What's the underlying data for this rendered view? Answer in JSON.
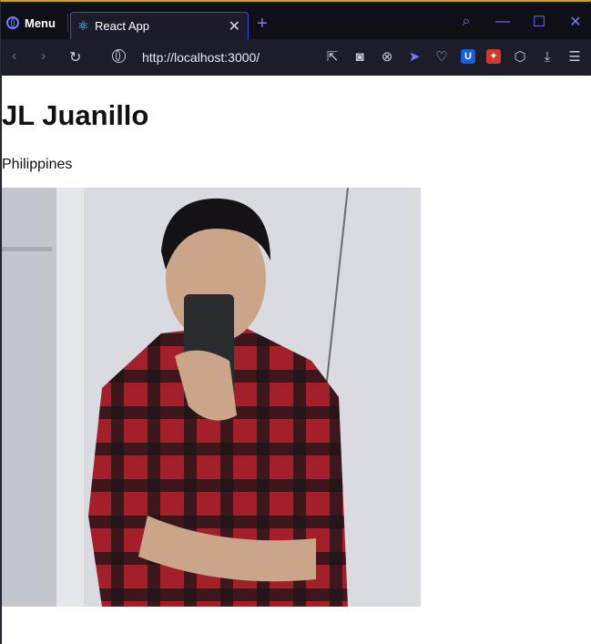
{
  "browser": {
    "menu_label": "Menu",
    "tab_title": "React App",
    "url": "http://localhost:3000/"
  },
  "page": {
    "name": "JL Juanillo",
    "country": "Philippines"
  },
  "colors": {
    "accent": "#6f7cff",
    "tab_border": "#3f4ad6",
    "react": "#61dafb",
    "shirt_red": "#a3202a"
  },
  "icons": [
    "opera-logo-icon",
    "react-icon",
    "close-icon",
    "plus-icon",
    "search-icon",
    "minimize-icon",
    "maximize-icon",
    "close-window-icon",
    "back-icon",
    "forward-icon",
    "reload-icon",
    "globe-icon",
    "share-icon",
    "camera-icon",
    "shield-icon",
    "send-icon",
    "heart-icon",
    "bitwarden-icon",
    "extension-icon",
    "box-icon",
    "download-icon",
    "settings-icon"
  ]
}
